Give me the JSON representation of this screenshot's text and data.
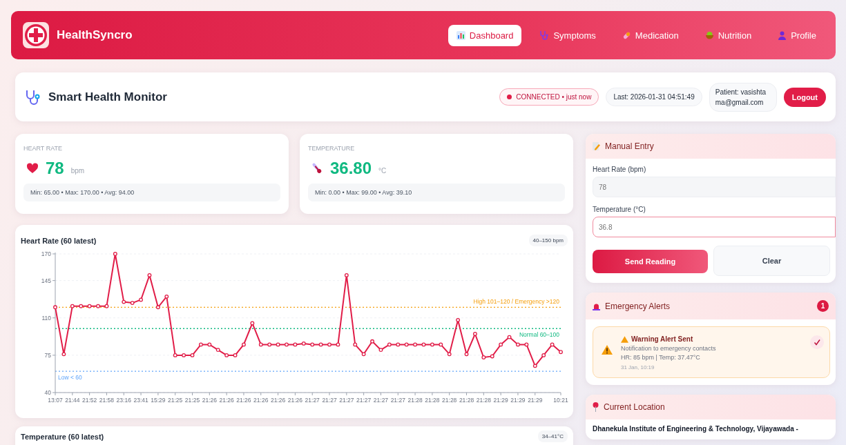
{
  "app": {
    "name": "HealthSyncro"
  },
  "nav": [
    {
      "label": "Dashboard",
      "kind": "chart",
      "selected": true
    },
    {
      "label": "Symptoms",
      "kind": "stethoscope",
      "selected": false
    },
    {
      "label": "Medication",
      "kind": "pill",
      "selected": false
    },
    {
      "label": "Nutrition",
      "kind": "bowl",
      "selected": false
    },
    {
      "label": "Profile",
      "kind": "person",
      "selected": false
    }
  ],
  "header": {
    "title": "Smart Health Monitor",
    "connection": {
      "text": "CONNECTED • just now",
      "connected": true
    },
    "last_update": "Last: 2026-01-31 04:51:49",
    "patient": "Patient: vasishtama@gmail.com",
    "logout": "Logout"
  },
  "stats": [
    {
      "kind": "heart",
      "label": "HEART RATE",
      "value": "78",
      "unit": "bpm",
      "summary": "Min: 65.00 • Max: 170.00 • Avg: 94.00"
    },
    {
      "kind": "temperature",
      "label": "TEMPERATURE",
      "value": "36.80",
      "unit": "°C",
      "summary": "Min: 0.00 • Max: 99.00 • Avg: 39.10"
    }
  ],
  "heart_chart": {
    "title": "Heart Rate (60 latest)",
    "range": "40–150 bpm",
    "chart_data": {
      "type": "line",
      "grid": true,
      "ylim": [
        40,
        170
      ],
      "yticks": [
        40,
        75,
        110,
        145,
        170
      ],
      "categories": [
        "13:07",
        null,
        "21:44",
        null,
        "21:52",
        null,
        "21:58",
        null,
        "23:16",
        null,
        "23:41",
        null,
        "15:29",
        null,
        "21:25",
        null,
        "21:25",
        null,
        "21:26",
        null,
        "21:26",
        null,
        "21:26",
        null,
        "21:26",
        null,
        "21:26",
        null,
        "21:26",
        null,
        "21:27",
        null,
        "21:27",
        null,
        "21:27",
        null,
        "21:27",
        null,
        "21:27",
        null,
        "21:27",
        null,
        "21:28",
        null,
        "21:28",
        null,
        "21:28",
        null,
        "21:28",
        null,
        "21:28",
        null,
        "21:29",
        null,
        "21:29",
        null,
        "21:29",
        null,
        null,
        "10:21"
      ],
      "series": [
        {
          "color": "#e11d48",
          "marker": "o",
          "values": [
            120,
            76,
            121,
            121,
            121,
            121,
            121,
            170,
            125,
            124,
            127,
            150,
            120,
            130,
            75,
            75,
            75,
            85,
            85,
            80,
            75,
            75,
            85,
            105,
            85,
            85,
            85,
            85,
            85,
            86,
            85,
            85,
            85,
            85,
            150,
            85,
            76,
            88,
            80,
            85,
            85,
            85,
            85,
            85,
            85,
            85,
            76,
            108,
            76,
            95,
            73,
            74,
            85,
            92,
            85,
            85,
            65,
            75,
            85,
            78
          ]
        }
      ],
      "ref_lines": [
        {
          "axis": "y",
          "value": 120,
          "label": "High 101–120 / Emergency >120",
          "color": "#f59e0b"
        },
        {
          "axis": "y",
          "value": 100,
          "label": "Normal 60–100",
          "color": "#10b981"
        },
        {
          "axis": "y",
          "value": 60,
          "label": "Low < 60",
          "color": "#60a5fa"
        }
      ]
    }
  },
  "temperature_chart": {
    "title": "Temperature (60 latest)",
    "range": "34–41°C"
  },
  "manual_entry": {
    "title": "Manual Entry",
    "fields": [
      {
        "label": "Heart Rate (bpm)",
        "placeholder": "78",
        "focused": false
      },
      {
        "label": "Temperature (°C)",
        "placeholder": "36.8",
        "focused": true
      }
    ],
    "buttons": [
      {
        "label": "Send Reading",
        "kind": "primary"
      },
      {
        "label": "Clear",
        "kind": "secondary"
      }
    ]
  },
  "alerts": {
    "title": "Emergency Alerts",
    "count": "1",
    "items": [
      {
        "title": "Warning Alert Sent",
        "message": "Notification to emergency contacts",
        "reading": "HR: 85 bpm | Temp: 37.47°C",
        "time": "31 Jan, 10:19",
        "acknowledged": true
      }
    ]
  },
  "location": {
    "title": "Current Location",
    "address": "Dhanekula Institute of Engineering & Technology, Vijayawada -"
  }
}
